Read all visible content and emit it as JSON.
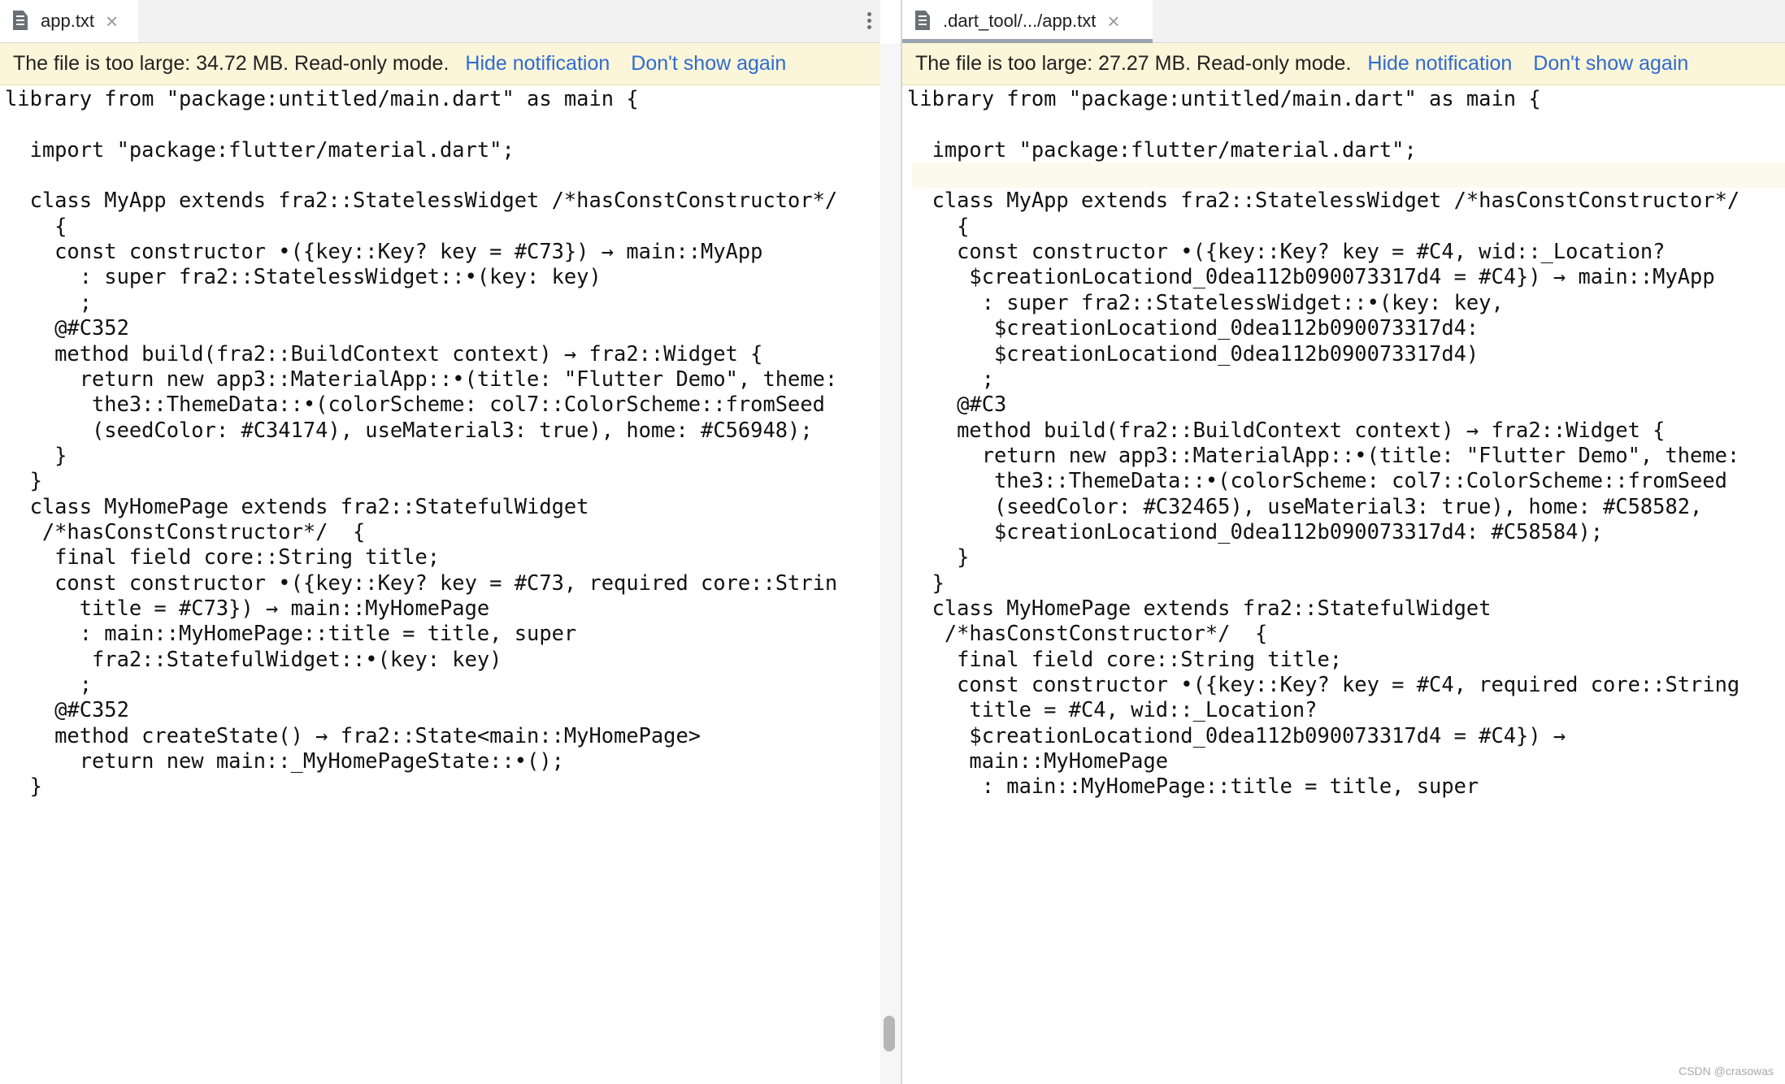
{
  "left": {
    "tab": {
      "label": "app.txt"
    },
    "notification": {
      "message": "The file is too large: 34.72 MB. Read-only mode.",
      "hide": "Hide notification",
      "dont_show": "Don't show again"
    },
    "lines": [
      "library from \"package:untitled/main.dart\" as main {",
      "",
      "  import \"package:flutter/material.dart\";",
      "",
      "  class MyApp extends fra2::StatelessWidget /*hasConstConstructor*/",
      "    {",
      "    const constructor •({key::Key? key = #C73}) → main::MyApp",
      "      : super fra2::StatelessWidget::•(key: key)",
      "      ;",
      "    @#C352",
      "    method build(fra2::BuildContext context) → fra2::Widget {",
      "      return new app3::MaterialApp::•(title: \"Flutter Demo\", theme:",
      "       the3::ThemeData::•(colorScheme: col7::ColorScheme::fromSeed",
      "       (seedColor: #C34174), useMaterial3: true), home: #C56948);",
      "    }",
      "  }",
      "  class MyHomePage extends fra2::StatefulWidget",
      "   /*hasConstConstructor*/  {",
      "    final field core::String title;",
      "    const constructor •({key::Key? key = #C73, required core::Strin",
      "      title = #C73}) → main::MyHomePage",
      "      : main::MyHomePage::title = title, super",
      "       fra2::StatefulWidget::•(key: key)",
      "      ;",
      "    @#C352",
      "    method createState() → fra2::State<main::MyHomePage>",
      "      return new main::_MyHomePageState::•();",
      "  }"
    ]
  },
  "right": {
    "tab": {
      "label": ".dart_tool/.../app.txt"
    },
    "notification": {
      "message": "The file is too large: 27.27 MB. Read-only mode.",
      "hide": "Hide notification",
      "dont_show": "Don't show again"
    },
    "lines": [
      "library from \"package:untitled/main.dart\" as main {",
      "",
      "  import \"package:flutter/material.dart\";",
      "",
      "  class MyApp extends fra2::StatelessWidget /*hasConstConstructor*/",
      "    {",
      "    const constructor •({key::Key? key = #C4, wid::_Location?",
      "     $creationLocationd_0dea112b090073317d4 = #C4}) → main::MyApp",
      "      : super fra2::StatelessWidget::•(key: key,",
      "       $creationLocationd_0dea112b090073317d4:",
      "       $creationLocationd_0dea112b090073317d4)",
      "      ;",
      "    @#C3",
      "    method build(fra2::BuildContext context) → fra2::Widget {",
      "      return new app3::MaterialApp::•(title: \"Flutter Demo\", theme:",
      "       the3::ThemeData::•(colorScheme: col7::ColorScheme::fromSeed",
      "       (seedColor: #C32465), useMaterial3: true), home: #C58582,",
      "       $creationLocationd_0dea112b090073317d4: #C58584);",
      "    }",
      "  }",
      "  class MyHomePage extends fra2::StatefulWidget",
      "   /*hasConstConstructor*/  {",
      "    final field core::String title;",
      "    const constructor •({key::Key? key = #C4, required core::String",
      "     title = #C4, wid::_Location?",
      "     $creationLocationd_0dea112b090073317d4 = #C4}) →",
      "     main::MyHomePage",
      "      : main::MyHomePage::title = title, super"
    ]
  },
  "watermark": "CSDN @crasowas"
}
